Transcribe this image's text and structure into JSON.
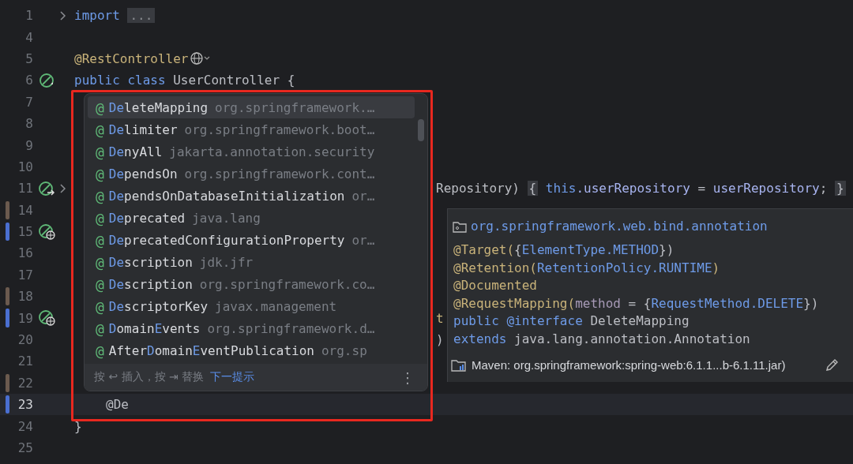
{
  "editor": {
    "lines": [
      {
        "number": "1",
        "fold": true,
        "code": [
          {
            "kind": "keyword",
            "text": "import"
          },
          {
            "kind": "folded",
            "text": "..."
          }
        ]
      },
      {
        "number": "4"
      },
      {
        "number": "5",
        "inlay": true,
        "code": [
          {
            "kind": "annotation",
            "text": "@RestController"
          }
        ]
      },
      {
        "number": "6",
        "kind": "bean",
        "code": [
          {
            "kind": "keyword",
            "text": "public class"
          },
          {
            "kind": "plain",
            "text": " UserController {"
          }
        ]
      },
      {
        "number": "7"
      },
      {
        "number": "8"
      },
      {
        "number": "9"
      },
      {
        "number": "10"
      },
      {
        "number": "11",
        "kind": "bean-arrow",
        "fold": true,
        "code_right": [
          {
            "kind": "plain",
            "text": "Repository) "
          },
          {
            "kind": "brace",
            "text": "{"
          },
          {
            "kind": "keyword",
            "text": " this"
          },
          {
            "kind": "field",
            "text": ".userRepository"
          },
          {
            "kind": "plain",
            "text": " = "
          },
          {
            "kind": "field",
            "text": "userRepository"
          },
          {
            "kind": "plain",
            "text": "; "
          },
          {
            "kind": "brace",
            "text": "}"
          }
        ]
      },
      {
        "number": "14",
        "color": "#6b5a4e"
      },
      {
        "number": "15",
        "color": "#4a6fd1",
        "kind": "web"
      },
      {
        "number": "16"
      },
      {
        "number": "17"
      },
      {
        "number": "18",
        "color": "#6b5a4e"
      },
      {
        "number": "19",
        "color": "#4a6fd1",
        "kind": "web",
        "code_right": [
          {
            "kind": "annotation",
            "text": "t"
          }
        ]
      },
      {
        "number": "20",
        "code_right": [
          {
            "kind": "plain",
            "text": ")"
          }
        ]
      },
      {
        "number": "21"
      },
      {
        "number": "22",
        "color": "#6b5a4e"
      },
      {
        "number": "23",
        "color": "#4a6fd1",
        "current": true,
        "indented": true,
        "code": [
          {
            "kind": "plain",
            "text": "@De"
          }
        ]
      },
      {
        "number": "24",
        "code": [
          {
            "kind": "plain",
            "text": "}"
          }
        ]
      },
      {
        "number": "25"
      }
    ]
  },
  "completion": {
    "items": [
      {
        "icon": "@",
        "parts": [
          {
            "text": "De",
            "match": true
          },
          {
            "text": "leteMapping",
            "match": false
          }
        ],
        "package": "org.springframework.…",
        "selected": true
      },
      {
        "icon": "@",
        "parts": [
          {
            "text": "De",
            "match": true
          },
          {
            "text": "limiter",
            "match": false
          }
        ],
        "package": "org.springframework.boot…",
        "selected": false
      },
      {
        "icon": "@",
        "parts": [
          {
            "text": "De",
            "match": true
          },
          {
            "text": "nyAll",
            "match": false
          }
        ],
        "package": "jakarta.annotation.security",
        "selected": false
      },
      {
        "icon": "@",
        "parts": [
          {
            "text": "De",
            "match": true
          },
          {
            "text": "pendsOn",
            "match": false
          }
        ],
        "package": "org.springframework.cont…",
        "selected": false
      },
      {
        "icon": "@",
        "parts": [
          {
            "text": "De",
            "match": true
          },
          {
            "text": "pendsOnDatabaseInitialization",
            "match": false
          }
        ],
        "package": "or…",
        "selected": false
      },
      {
        "icon": "@",
        "parts": [
          {
            "text": "De",
            "match": true
          },
          {
            "text": "precated",
            "match": false
          }
        ],
        "package": "java.lang",
        "selected": false
      },
      {
        "icon": "@",
        "parts": [
          {
            "text": "De",
            "match": true
          },
          {
            "text": "precatedConfigurationProperty",
            "match": false
          }
        ],
        "package": "or…",
        "selected": false
      },
      {
        "icon": "@",
        "parts": [
          {
            "text": "De",
            "match": true
          },
          {
            "text": "scription",
            "match": false
          }
        ],
        "package": "jdk.jfr",
        "selected": false
      },
      {
        "icon": "@",
        "parts": [
          {
            "text": "De",
            "match": true
          },
          {
            "text": "scription",
            "match": false
          }
        ],
        "package": "org.springframework.co…",
        "selected": false
      },
      {
        "icon": "@",
        "parts": [
          {
            "text": "De",
            "match": true
          },
          {
            "text": "scriptorKey",
            "match": false
          }
        ],
        "package": "javax.management",
        "selected": false
      },
      {
        "icon": "@",
        "parts": [
          {
            "text": "D",
            "match": true
          },
          {
            "text": "omain",
            "match": false
          },
          {
            "text": "E",
            "match": true
          },
          {
            "text": "vents",
            "match": false
          }
        ],
        "package": "org.springframework.d…",
        "selected": false
      },
      {
        "icon": "@",
        "parts": [
          {
            "text": "After",
            "match": false
          },
          {
            "text": "D",
            "match": true
          },
          {
            "text": "omain",
            "match": false
          },
          {
            "text": "E",
            "match": true
          },
          {
            "text": "ventPublication",
            "match": false
          }
        ],
        "package": "org.sp",
        "selected": false
      }
    ],
    "hint": "按 ↩ 插入，按 ⇥ 替换",
    "next_link": "下一提示",
    "menu": "⋮"
  },
  "documentation": {
    "package": "org.springframework.web.bind.annotation",
    "lines": [
      [
        {
          "kind": "annotation",
          "text": "@Target("
        },
        {
          "kind": "punct",
          "text": "{"
        },
        {
          "kind": "type",
          "text": "ElementType.METHOD"
        },
        {
          "kind": "punct",
          "text": "})"
        }
      ],
      [
        {
          "kind": "annotation",
          "text": "@Retention("
        },
        {
          "kind": "type",
          "text": "RetentionPolicy.RUNTIME"
        },
        {
          "kind": "annotation",
          "text": ")"
        }
      ],
      [
        {
          "kind": "annotation",
          "text": "@Documented"
        }
      ],
      [
        {
          "kind": "annotation",
          "text": "@RequestMapping("
        },
        {
          "kind": "param",
          "text": "method"
        },
        {
          "kind": "punct",
          "text": " = {"
        },
        {
          "kind": "type",
          "text": "RequestMethod.DELETE"
        },
        {
          "kind": "punct",
          "text": "})"
        }
      ],
      [
        {
          "kind": "keyword",
          "text": "public"
        },
        {
          "kind": "keyword",
          "text": " @interface"
        },
        {
          "kind": "plain",
          "text": " DeleteMapping"
        }
      ],
      [
        {
          "kind": "keyword",
          "text": "extends"
        },
        {
          "kind": "plain",
          "text": " java.lang.annotation.Annotation"
        }
      ]
    ],
    "source": "Maven: org.springframework:spring-web:6.1.1...b-6.1.11.jar)"
  }
}
